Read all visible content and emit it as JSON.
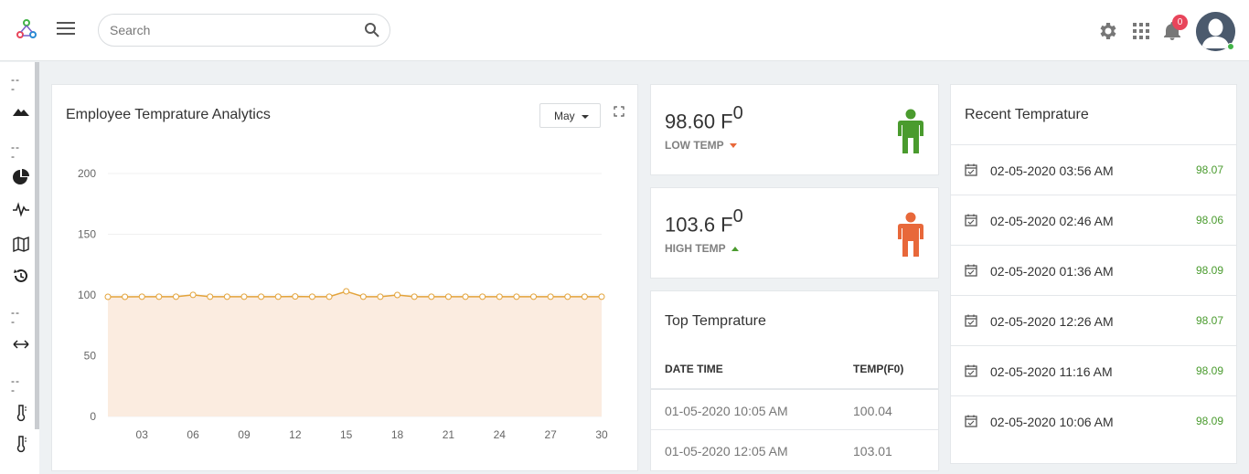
{
  "header": {
    "search_placeholder": "Search",
    "notification_count": "0"
  },
  "sidebar": {
    "dashes": [
      "---",
      "---",
      "---",
      "---"
    ],
    "icons": [
      "mountain-icon",
      "pie-chart-icon",
      "pulse-icon",
      "map-icon",
      "history-icon",
      "resize-horizontal-icon",
      "thermometer-icon",
      "thermometer-icon"
    ]
  },
  "chart_card": {
    "title": "Employee Temprature Analytics",
    "month": "May"
  },
  "chart_data": {
    "type": "area",
    "title": "Employee Temprature Analytics",
    "xlabel": "",
    "ylabel": "",
    "ylim": [
      0,
      200
    ],
    "yticks": [
      0,
      50,
      100,
      150,
      200
    ],
    "xticks": [
      "03",
      "06",
      "09",
      "12",
      "15",
      "18",
      "21",
      "24",
      "27",
      "30"
    ],
    "x": [
      1,
      2,
      3,
      4,
      5,
      6,
      7,
      8,
      9,
      10,
      11,
      12,
      13,
      14,
      15,
      16,
      17,
      18,
      19,
      20,
      21,
      22,
      23,
      24,
      25,
      26,
      27,
      28,
      29,
      30
    ],
    "values": [
      98.5,
      98.5,
      98.6,
      98.6,
      98.6,
      100.1,
      98.6,
      98.6,
      98.6,
      98.6,
      98.6,
      98.8,
      98.6,
      98.6,
      103.0,
      98.6,
      98.6,
      100.0,
      98.6,
      98.6,
      98.6,
      98.6,
      98.6,
      98.6,
      98.6,
      98.6,
      98.6,
      98.6,
      98.6,
      98.6
    ],
    "grid": true,
    "colors": {
      "line": "#e3a33a",
      "fill": "#fbece0"
    }
  },
  "low_temp": {
    "value": "98.60 F",
    "superscript": "0",
    "label": "LOW TEMP",
    "color": "#4a9b2e"
  },
  "high_temp": {
    "value": "103.6 F",
    "superscript": "0",
    "label": "HIGH TEMP",
    "color": "#e8683a"
  },
  "top_temp": {
    "title": "Top Temprature",
    "columns": [
      "DATE TIME",
      "TEMP(F0)"
    ],
    "rows": [
      {
        "datetime": "01-05-2020 10:05 AM",
        "temp": "100.04"
      },
      {
        "datetime": "01-05-2020 12:05 AM",
        "temp": "103.01"
      }
    ]
  },
  "recent": {
    "title": "Recent Temprature",
    "rows": [
      {
        "datetime": "02-05-2020 03:56 AM",
        "temp": "98.07"
      },
      {
        "datetime": "02-05-2020 02:46 AM",
        "temp": "98.06"
      },
      {
        "datetime": "02-05-2020 01:36 AM",
        "temp": "98.09"
      },
      {
        "datetime": "02-05-2020 12:26 AM",
        "temp": "98.07"
      },
      {
        "datetime": "02-05-2020 11:16 AM",
        "temp": "98.09"
      },
      {
        "datetime": "02-05-2020 10:06 AM",
        "temp": "98.09"
      }
    ]
  }
}
